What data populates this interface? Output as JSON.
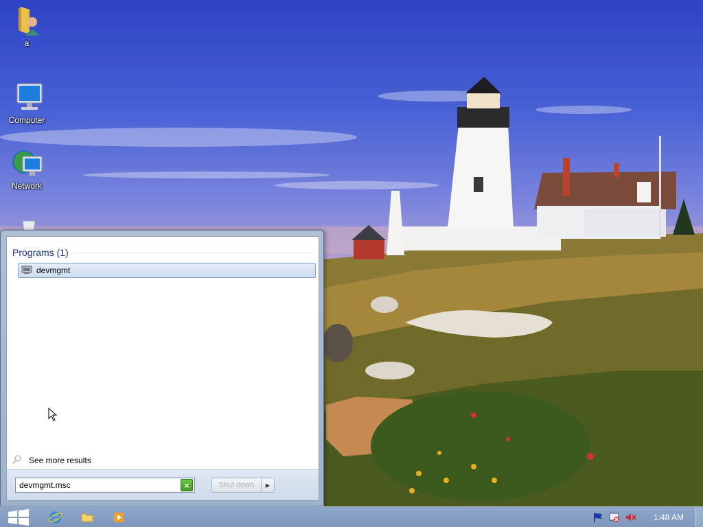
{
  "desktop": {
    "icons": [
      {
        "label": "a",
        "icon": "user-folder-icon"
      },
      {
        "label": "Computer",
        "icon": "computer-icon"
      },
      {
        "label": "Network",
        "icon": "network-icon"
      },
      {
        "label": "",
        "icon": "recycle-bin-icon"
      }
    ],
    "wallpaper": "lighthouse-landscape"
  },
  "start_menu": {
    "programs_header": "Programs (1)",
    "results": [
      {
        "label": "devmgmt",
        "icon": "device-manager-icon",
        "selected": true
      }
    ],
    "see_more": "See more results",
    "search": {
      "value": "devmgmt.msc",
      "clear_icon": "clear-search-icon"
    },
    "shutdown": {
      "label": "Shut down",
      "arrow_icon": "chevron-right-icon"
    }
  },
  "taskbar": {
    "start_icon": "windows-logo-icon",
    "pinned": [
      {
        "name": "internet-explorer",
        "icon": "ie-icon"
      },
      {
        "name": "file-explorer",
        "icon": "folder-icon"
      },
      {
        "name": "media-player",
        "icon": "media-player-icon"
      }
    ],
    "tray": [
      {
        "name": "action-center",
        "icon": "flag-icon"
      },
      {
        "name": "network-status",
        "icon": "network-error-icon"
      },
      {
        "name": "volume",
        "icon": "speaker-muted-icon"
      }
    ],
    "clock": "1:48 AM"
  },
  "colors": {
    "menu_header": "#1e3287",
    "selection_border": "#7da2ce",
    "clear_button": "#3e9a25",
    "taskbar": "#8ea6c8"
  }
}
